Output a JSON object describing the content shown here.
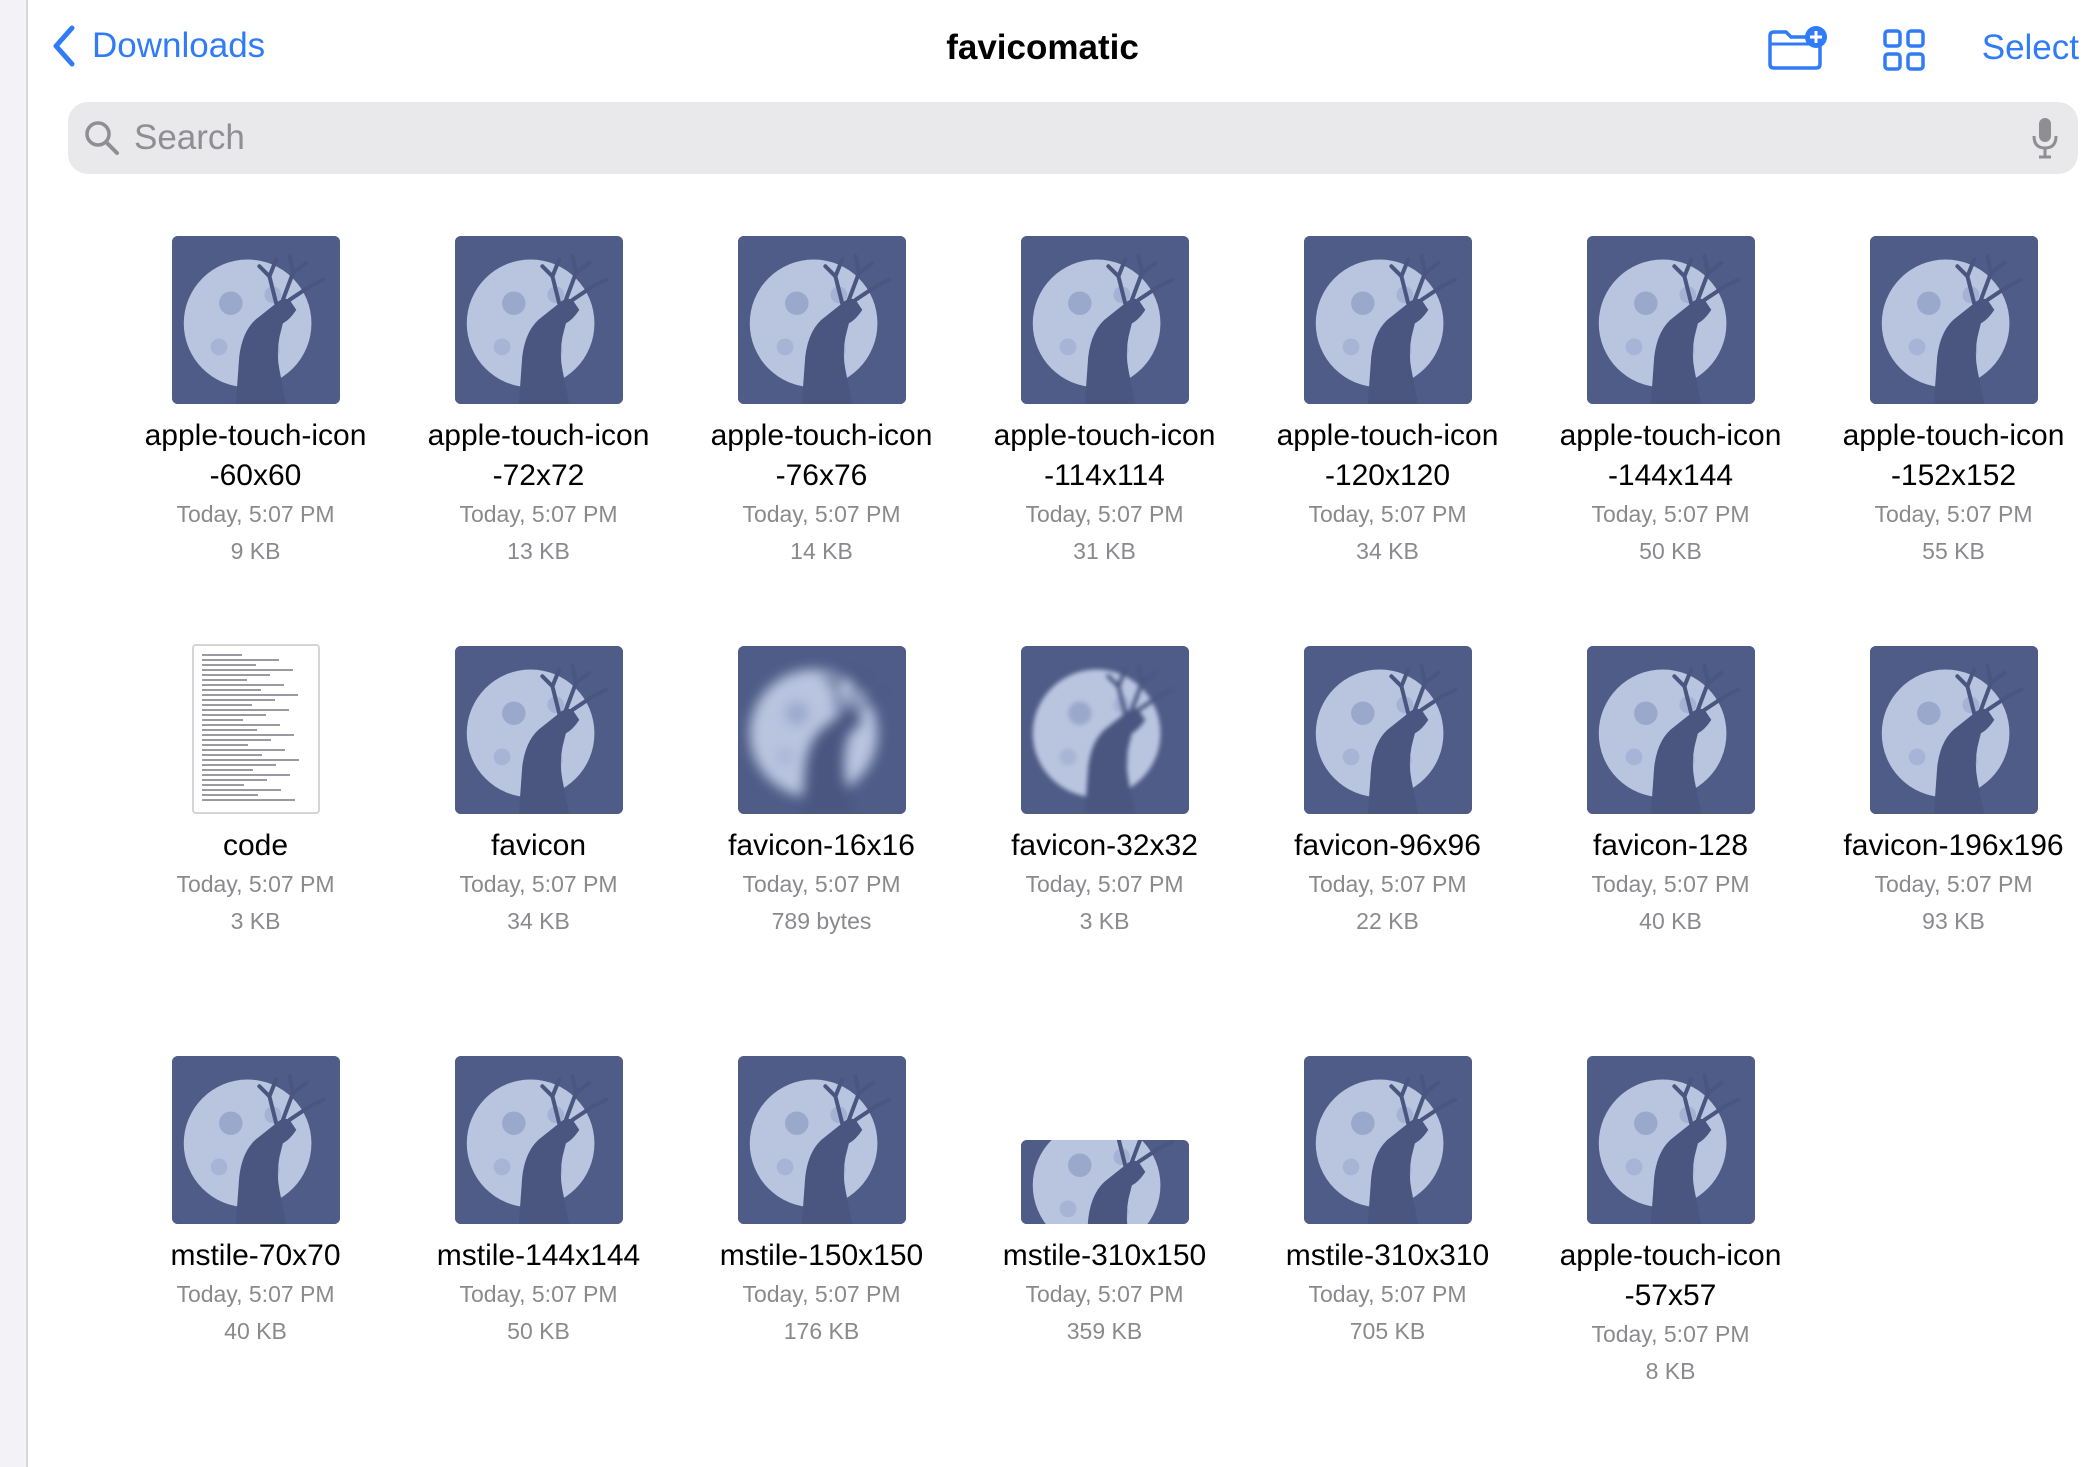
{
  "nav": {
    "back_label": "Downloads",
    "title": "favicomatic",
    "select_label": "Select"
  },
  "search": {
    "placeholder": "Search"
  },
  "colors": {
    "accent": "#2f7cf6",
    "thumb_bg": "#4f5c87",
    "meta_text": "#8a8a8e"
  },
  "files": [
    {
      "name": "apple-touch-icon-60x60",
      "date": "Today, 5:07 PM",
      "size": "9 KB",
      "kind": "image"
    },
    {
      "name": "apple-touch-icon-72x72",
      "date": "Today, 5:07 PM",
      "size": "13 KB",
      "kind": "image"
    },
    {
      "name": "apple-touch-icon-76x76",
      "date": "Today, 5:07 PM",
      "size": "14 KB",
      "kind": "image"
    },
    {
      "name": "apple-touch-icon-114x114",
      "date": "Today, 5:07 PM",
      "size": "31 KB",
      "kind": "image"
    },
    {
      "name": "apple-touch-icon-120x120",
      "date": "Today, 5:07 PM",
      "size": "34 KB",
      "kind": "image"
    },
    {
      "name": "apple-touch-icon-144x144",
      "date": "Today, 5:07 PM",
      "size": "50 KB",
      "kind": "image"
    },
    {
      "name": "apple-touch-icon-152x152",
      "date": "Today, 5:07 PM",
      "size": "55 KB",
      "kind": "image"
    },
    {
      "name": "code",
      "date": "Today, 5:07 PM",
      "size": "3 KB",
      "kind": "document"
    },
    {
      "name": "favicon",
      "date": "Today, 5:07 PM",
      "size": "34 KB",
      "kind": "image"
    },
    {
      "name": "favicon-16x16",
      "date": "Today, 5:07 PM",
      "size": "789 bytes",
      "kind": "image-pixelated"
    },
    {
      "name": "favicon-32x32",
      "date": "Today, 5:07 PM",
      "size": "3 KB",
      "kind": "image-soft"
    },
    {
      "name": "favicon-96x96",
      "date": "Today, 5:07 PM",
      "size": "22 KB",
      "kind": "image"
    },
    {
      "name": "favicon-128",
      "date": "Today, 5:07 PM",
      "size": "40 KB",
      "kind": "image"
    },
    {
      "name": "favicon-196x196",
      "date": "Today, 5:07 PM",
      "size": "93 KB",
      "kind": "image"
    },
    {
      "name": "mstile-70x70",
      "date": "Today, 5:07 PM",
      "size": "40 KB",
      "kind": "image"
    },
    {
      "name": "mstile-144x144",
      "date": "Today, 5:07 PM",
      "size": "50 KB",
      "kind": "image"
    },
    {
      "name": "mstile-150x150",
      "date": "Today, 5:07 PM",
      "size": "176 KB",
      "kind": "image"
    },
    {
      "name": "mstile-310x150",
      "date": "Today, 5:07 PM",
      "size": "359 KB",
      "kind": "image-wide"
    },
    {
      "name": "mstile-310x310",
      "date": "Today, 5:07 PM",
      "size": "705 KB",
      "kind": "image"
    },
    {
      "name": "apple-touch-icon-57x57",
      "date": "Today, 5:07 PM",
      "size": "8 KB",
      "kind": "image"
    }
  ]
}
